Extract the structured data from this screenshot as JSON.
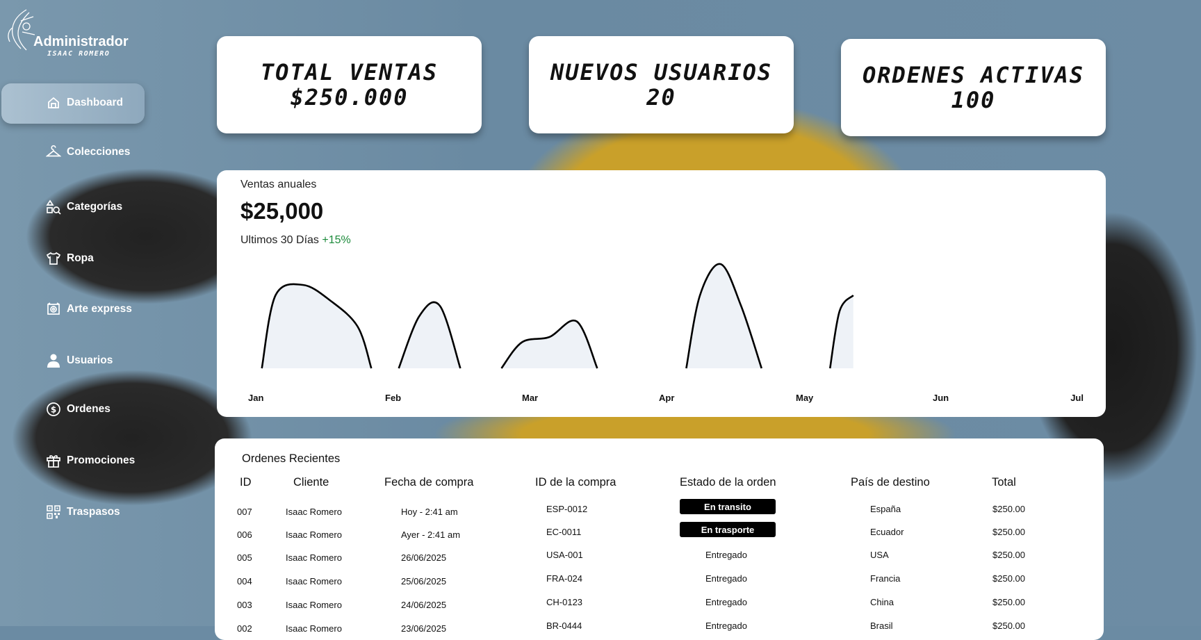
{
  "sidebar": {
    "admin_title": "Administrador",
    "admin_subtitle": "ISAAC ROMERO",
    "items": [
      {
        "label": "Dashboard",
        "icon": "home-icon",
        "active": true
      },
      {
        "label": "Colecciones",
        "icon": "hanger-icon"
      },
      {
        "label": "Categorías",
        "icon": "shapes-search-icon"
      },
      {
        "label": "Ropa",
        "icon": "shirt-icon"
      },
      {
        "label": "Arte express",
        "icon": "art-icon"
      },
      {
        "label": "Usuarios",
        "icon": "user-icon"
      },
      {
        "label": "Ordenes",
        "icon": "dollar-icon"
      },
      {
        "label": "Promociones",
        "icon": "gift-icon"
      },
      {
        "label": "Traspasos",
        "icon": "qr-icon"
      }
    ]
  },
  "kpis": [
    {
      "label": "TOTAL VENTAS",
      "value": "$250.000"
    },
    {
      "label": "NUEVOS USUARIOS",
      "value": "20"
    },
    {
      "label": "ORDENES ACTIVAS",
      "value": "100"
    }
  ],
  "sales": {
    "label": "Ventas anuales",
    "value": "$25,000",
    "period": "Ultimos 30 Días",
    "change": "+15%"
  },
  "chart_data": {
    "type": "line",
    "categories": [
      "Jan",
      "Feb",
      "Mar",
      "Apr",
      "May",
      "Jun",
      "Jul"
    ],
    "ylim": [
      0,
      100
    ],
    "segments": [
      {
        "x": [
          0.1,
          0.2,
          0.4,
          0.6,
          0.8,
          0.9
        ],
        "y": [
          0,
          70,
          80,
          65,
          40,
          0
        ]
      },
      {
        "x": [
          1.1,
          1.25,
          1.4,
          1.55
        ],
        "y": [
          0,
          50,
          60,
          0
        ]
      },
      {
        "x": [
          1.85,
          2.0,
          2.2,
          2.4,
          2.55
        ],
        "y": [
          0,
          25,
          30,
          45,
          0
        ]
      },
      {
        "x": [
          3.2,
          3.3,
          3.45,
          3.6,
          3.75
        ],
        "y": [
          0,
          70,
          100,
          60,
          0
        ]
      },
      {
        "x": [
          4.25,
          4.32,
          4.42
        ],
        "y": [
          0,
          55,
          70
        ]
      }
    ],
    "line_color": "#000000",
    "grid": false
  },
  "orders": {
    "title": "Ordenes Recientes",
    "columns": [
      "ID",
      "Cliente",
      "Fecha de compra",
      "ID de la compra",
      "Estado de la orden",
      "País de destino",
      "Total"
    ],
    "rows": [
      {
        "id": "007",
        "cliente": "Isaac Romero",
        "fecha": "Hoy - 2:41 am",
        "compra": "ESP-0012",
        "estado": "En transito",
        "badge": true,
        "pais": "España",
        "total": "$250.00"
      },
      {
        "id": "006",
        "cliente": "Isaac Romero",
        "fecha": "Ayer - 2:41 am",
        "compra": "EC-0011",
        "estado": "En trasporte",
        "badge": true,
        "pais": "Ecuador",
        "total": "$250.00"
      },
      {
        "id": "005",
        "cliente": "Isaac Romero",
        "fecha": "26/06/2025",
        "compra": "USA-001",
        "estado": "Entregado",
        "badge": false,
        "pais": "USA",
        "total": "$250.00"
      },
      {
        "id": "004",
        "cliente": "Isaac Romero",
        "fecha": "25/06/2025",
        "compra": "FRA-024",
        "estado": "Entregado",
        "badge": false,
        "pais": "Francia",
        "total": "$250.00"
      },
      {
        "id": "003",
        "cliente": "Isaac Romero",
        "fecha": "24/06/2025",
        "compra": "CH-0123",
        "estado": "Entregado",
        "badge": false,
        "pais": "China",
        "total": "$250.00"
      },
      {
        "id": "002",
        "cliente": "Isaac Romero",
        "fecha": "23/06/2025",
        "compra": "BR-0444",
        "estado": "Entregado",
        "badge": false,
        "pais": "Brasil",
        "total": "$250.00"
      }
    ]
  }
}
